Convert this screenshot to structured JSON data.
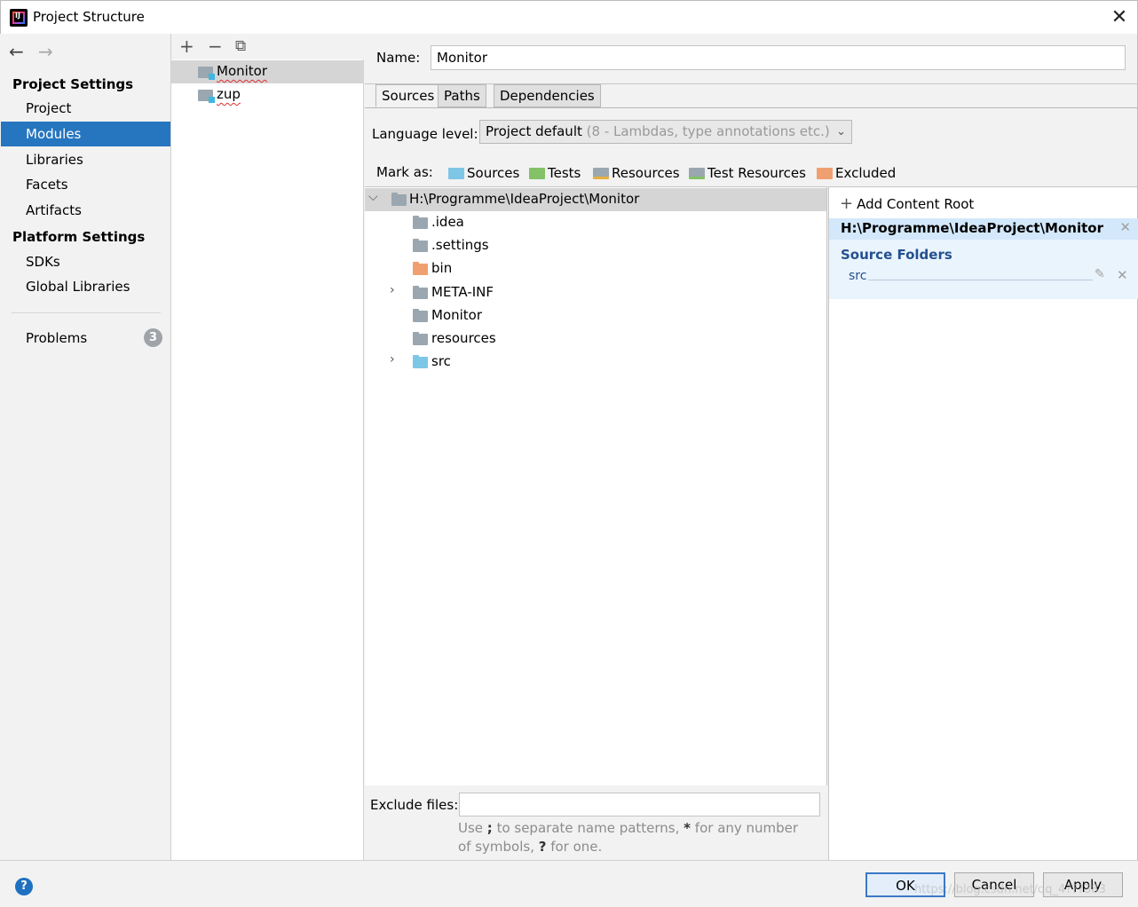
{
  "window": {
    "title": "Project Structure",
    "close_glyph": "✕"
  },
  "nav": {
    "back_glyph": "←",
    "forward_glyph": "→",
    "project_settings_header": "Project Settings",
    "project_settings_items": [
      "Project",
      "Modules",
      "Libraries",
      "Facets",
      "Artifacts"
    ],
    "selected_item": "Modules",
    "platform_settings_header": "Platform Settings",
    "platform_settings_items": [
      "SDKs",
      "Global Libraries"
    ],
    "problems_label": "Problems",
    "problems_count": "3"
  },
  "modules_toolbar": {
    "add_glyph": "+",
    "remove_glyph": "−",
    "copy_glyph": "⧉"
  },
  "modules": [
    "Monitor",
    "zup"
  ],
  "selected_module": "Monitor",
  "main": {
    "name_label": "Name:",
    "name_value": "Monitor",
    "tabs": [
      "Sources",
      "Paths",
      "Dependencies"
    ],
    "active_tab": "Sources",
    "language_level_label": "Language level:",
    "language_level_value": "Project default",
    "language_level_hint": "(8 - Lambdas, type annotations etc.)",
    "mark_as_label": "Mark as:",
    "mark_as": [
      {
        "label": "Sources",
        "color": "#7ec6e6"
      },
      {
        "label": "Tests",
        "color": "#83c266"
      },
      {
        "label": "Resources",
        "color": "#9aa7b0"
      },
      {
        "label": "Test Resources",
        "color": "#9aa7b0"
      },
      {
        "label": "Excluded",
        "color": "#f0a070"
      }
    ]
  },
  "tree": {
    "root": "H:\\Programme\\IdeaProject\\Monitor",
    "children": [
      {
        "label": ".idea",
        "color": "#9aa7b0",
        "expandable": false
      },
      {
        "label": ".settings",
        "color": "#9aa7b0",
        "expandable": false
      },
      {
        "label": "bin",
        "color": "#f0a070",
        "expandable": false
      },
      {
        "label": "META-INF",
        "color": "#9aa7b0",
        "expandable": true
      },
      {
        "label": "Monitor",
        "color": "#9aa7b0",
        "expandable": false
      },
      {
        "label": "resources",
        "color": "#9aa7b0",
        "expandable": false
      },
      {
        "label": "src",
        "color": "#7ec6e6",
        "expandable": true
      }
    ]
  },
  "content_roots": {
    "add_label": "Add Content Root",
    "root_path": "H:\\Programme\\IdeaProject\\Monitor",
    "source_folders_header": "Source Folders",
    "source_folders": [
      "src"
    ]
  },
  "exclude": {
    "label": "Exclude files:",
    "value": "",
    "hint_1": "Use ",
    "hint_sep": ";",
    "hint_2": " to separate name patterns, ",
    "hint_star": "*",
    "hint_3": " for any number of symbols, ",
    "hint_q": "?",
    "hint_4": " for one."
  },
  "buttons": {
    "ok": "OK",
    "cancel": "Cancel",
    "apply": "Apply",
    "help": "?"
  },
  "watermark": "https://blog.csdn.net/qq_4???383"
}
